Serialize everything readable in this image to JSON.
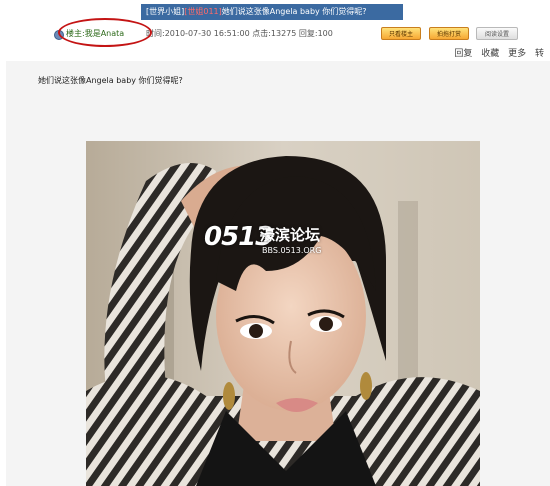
{
  "thread": {
    "forum_tag": "[世界小姐]",
    "mini_tag": "[世姐011]",
    "title": "她们说这张像Angela baby 你们觉得呢?"
  },
  "info": {
    "poster_label": "楼主:",
    "poster_name": "我是Anata",
    "meta": "时间:2010-07-30 16:51:00 点击:13275 回复:100"
  },
  "buttons": {
    "only_op": "只看楼主",
    "print": "拍拖打赏",
    "settings": "阅读设置"
  },
  "actions": [
    "回复",
    "收藏",
    "更多",
    "转"
  ],
  "post": {
    "heading": "她们说这张像Angela baby 你们觉得呢?"
  },
  "watermark": {
    "logo": "0513",
    "name": "濠滨论坛",
    "url": "BBS.0513.ORG"
  }
}
